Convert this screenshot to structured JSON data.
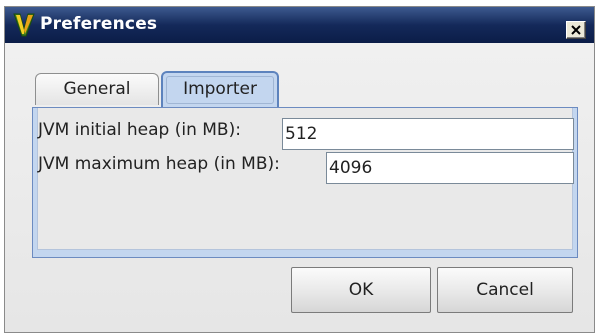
{
  "window": {
    "title": "Preferences",
    "icon": "app-v-logo-icon",
    "close_icon": "close-x-icon"
  },
  "tabs": [
    {
      "label": "General",
      "selected": false
    },
    {
      "label": "Importer",
      "selected": true
    }
  ],
  "importer": {
    "initial_heap_label": "JVM initial heap (in MB):",
    "initial_heap_value": "512",
    "max_heap_label": "JVM maximum heap (in MB):",
    "max_heap_value": "4096"
  },
  "buttons": {
    "ok_label": "OK",
    "cancel_label": "Cancel"
  },
  "colors": {
    "titlebar": "#14295a",
    "selected_tab": "#c3d6ef",
    "dialog_background": "#ececec"
  }
}
